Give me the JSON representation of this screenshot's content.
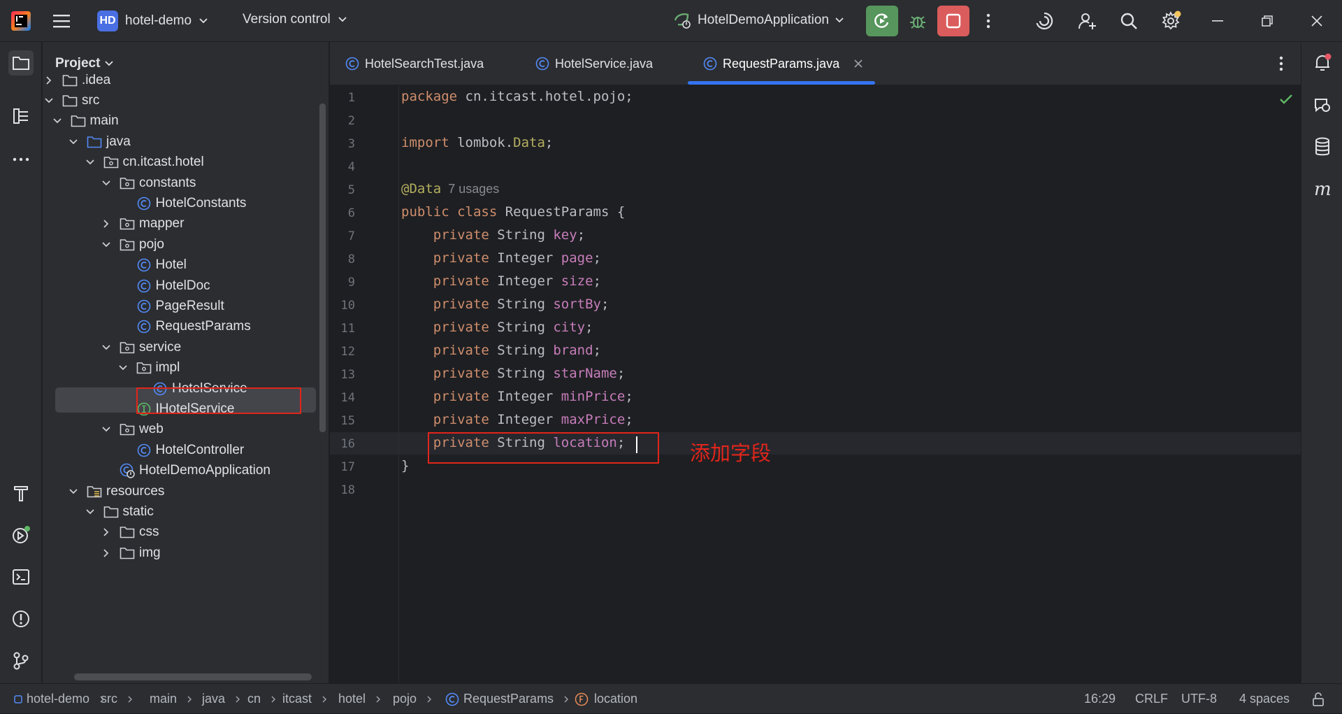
{
  "titlebar": {
    "project_badge": "HD",
    "project_name": "hotel-demo",
    "vcs_label": "Version control",
    "run_config": "HotelDemoApplication"
  },
  "colors": {
    "accent": "#3574f0",
    "run_green": "#57965c",
    "stop_red": "#db5c5c",
    "badge_blue": "#4a6fe3",
    "annotation_red": "#e1251b"
  },
  "project": {
    "header": "Project",
    "tree": [
      {
        "label": ".idea",
        "depth": 0,
        "arrow": "right",
        "icon": "folder-icon"
      },
      {
        "label": "src",
        "depth": 0,
        "arrow": "down",
        "icon": "folder-icon"
      },
      {
        "label": "main",
        "depth": 1,
        "arrow": "down",
        "icon": "folder-icon"
      },
      {
        "label": "java",
        "depth": 2,
        "arrow": "down",
        "icon": "source-folder-icon"
      },
      {
        "label": "cn.itcast.hotel",
        "depth": 3,
        "arrow": "down",
        "icon": "package-icon"
      },
      {
        "label": "constants",
        "depth": 4,
        "arrow": "down",
        "icon": "package-icon"
      },
      {
        "label": "HotelConstants",
        "depth": 5,
        "arrow": "",
        "icon": "class-icon"
      },
      {
        "label": "mapper",
        "depth": 4,
        "arrow": "right",
        "icon": "package-icon"
      },
      {
        "label": "pojo",
        "depth": 4,
        "arrow": "down",
        "icon": "package-icon"
      },
      {
        "label": "Hotel",
        "depth": 5,
        "arrow": "",
        "icon": "class-icon"
      },
      {
        "label": "HotelDoc",
        "depth": 5,
        "arrow": "",
        "icon": "class-icon"
      },
      {
        "label": "PageResult",
        "depth": 5,
        "arrow": "",
        "icon": "class-icon"
      },
      {
        "label": "RequestParams",
        "depth": 5,
        "arrow": "",
        "icon": "class-icon",
        "selected": true
      },
      {
        "label": "service",
        "depth": 4,
        "arrow": "down",
        "icon": "package-icon"
      },
      {
        "label": "impl",
        "depth": 5,
        "arrow": "down",
        "icon": "package-icon"
      },
      {
        "label": "HotelService",
        "depth": 6,
        "arrow": "",
        "icon": "class-icon"
      },
      {
        "label": "IHotelService",
        "depth": 5,
        "arrow": "",
        "icon": "interface-icon"
      },
      {
        "label": "web",
        "depth": 4,
        "arrow": "down",
        "icon": "package-icon"
      },
      {
        "label": "HotelController",
        "depth": 5,
        "arrow": "",
        "icon": "class-icon"
      },
      {
        "label": "HotelDemoApplication",
        "depth": 4,
        "arrow": "",
        "icon": "spring-app-icon"
      },
      {
        "label": "resources",
        "depth": 2,
        "arrow": "down",
        "icon": "resources-folder-icon"
      },
      {
        "label": "static",
        "depth": 3,
        "arrow": "down",
        "icon": "folder-icon"
      },
      {
        "label": "css",
        "depth": 4,
        "arrow": "right",
        "icon": "folder-icon"
      },
      {
        "label": "img",
        "depth": 4,
        "arrow": "right",
        "icon": "folder-icon"
      }
    ]
  },
  "tabs": [
    {
      "label": "HotelSearchTest.java",
      "active": false
    },
    {
      "label": "HotelService.java",
      "active": false
    },
    {
      "label": "RequestParams.java",
      "active": true
    }
  ],
  "editor": {
    "lines": [
      [
        {
          "t": "package ",
          "c": "kw"
        },
        {
          "t": "cn.itcast.hotel.pojo;",
          "c": ""
        }
      ],
      [],
      [
        {
          "t": "import ",
          "c": "kw"
        },
        {
          "t": "lombok.",
          "c": ""
        },
        {
          "t": "Data",
          "c": "ann"
        },
        {
          "t": ";",
          "c": ""
        }
      ],
      [],
      [
        {
          "t": "@Data",
          "c": "ann"
        },
        {
          "t": "  7 usages",
          "c": "hint"
        }
      ],
      [
        {
          "t": "public class ",
          "c": "kw"
        },
        {
          "t": "RequestParams {",
          "c": ""
        }
      ],
      [
        {
          "t": "    private ",
          "c": "kw"
        },
        {
          "t": "String ",
          "c": ""
        },
        {
          "t": "key",
          "c": "fld"
        },
        {
          "t": ";",
          "c": ""
        }
      ],
      [
        {
          "t": "    private ",
          "c": "kw"
        },
        {
          "t": "Integer ",
          "c": ""
        },
        {
          "t": "page",
          "c": "fld"
        },
        {
          "t": ";",
          "c": ""
        }
      ],
      [
        {
          "t": "    private ",
          "c": "kw"
        },
        {
          "t": "Integer ",
          "c": ""
        },
        {
          "t": "size",
          "c": "fld"
        },
        {
          "t": ";",
          "c": ""
        }
      ],
      [
        {
          "t": "    private ",
          "c": "kw"
        },
        {
          "t": "String ",
          "c": ""
        },
        {
          "t": "sortBy",
          "c": "fld"
        },
        {
          "t": ";",
          "c": ""
        }
      ],
      [
        {
          "t": "    private ",
          "c": "kw"
        },
        {
          "t": "String ",
          "c": ""
        },
        {
          "t": "city",
          "c": "fld"
        },
        {
          "t": ";",
          "c": ""
        }
      ],
      [
        {
          "t": "    private ",
          "c": "kw"
        },
        {
          "t": "String ",
          "c": ""
        },
        {
          "t": "brand",
          "c": "fld"
        },
        {
          "t": ";",
          "c": ""
        }
      ],
      [
        {
          "t": "    private ",
          "c": "kw"
        },
        {
          "t": "String ",
          "c": ""
        },
        {
          "t": "starName",
          "c": "fld"
        },
        {
          "t": ";",
          "c": ""
        }
      ],
      [
        {
          "t": "    private ",
          "c": "kw"
        },
        {
          "t": "Integer ",
          "c": ""
        },
        {
          "t": "minPrice",
          "c": "fld"
        },
        {
          "t": ";",
          "c": ""
        }
      ],
      [
        {
          "t": "    private ",
          "c": "kw"
        },
        {
          "t": "Integer ",
          "c": ""
        },
        {
          "t": "maxPrice",
          "c": "fld"
        },
        {
          "t": ";",
          "c": ""
        }
      ],
      [
        {
          "t": "    private ",
          "c": "kw"
        },
        {
          "t": "String ",
          "c": ""
        },
        {
          "t": "location",
          "c": "fld"
        },
        {
          "t": ";",
          "c": ""
        }
      ],
      [
        {
          "t": "}",
          "c": ""
        }
      ],
      []
    ],
    "annotation_text": "添加字段"
  },
  "statusbar": {
    "breadcrumbs": [
      "hotel-demo",
      "src",
      "main",
      "java",
      "cn",
      "itcast",
      "hotel",
      "pojo",
      "RequestParams",
      "location"
    ],
    "position": "16:29",
    "line_sep": "CRLF",
    "encoding": "UTF-8",
    "indent": "4 spaces"
  }
}
